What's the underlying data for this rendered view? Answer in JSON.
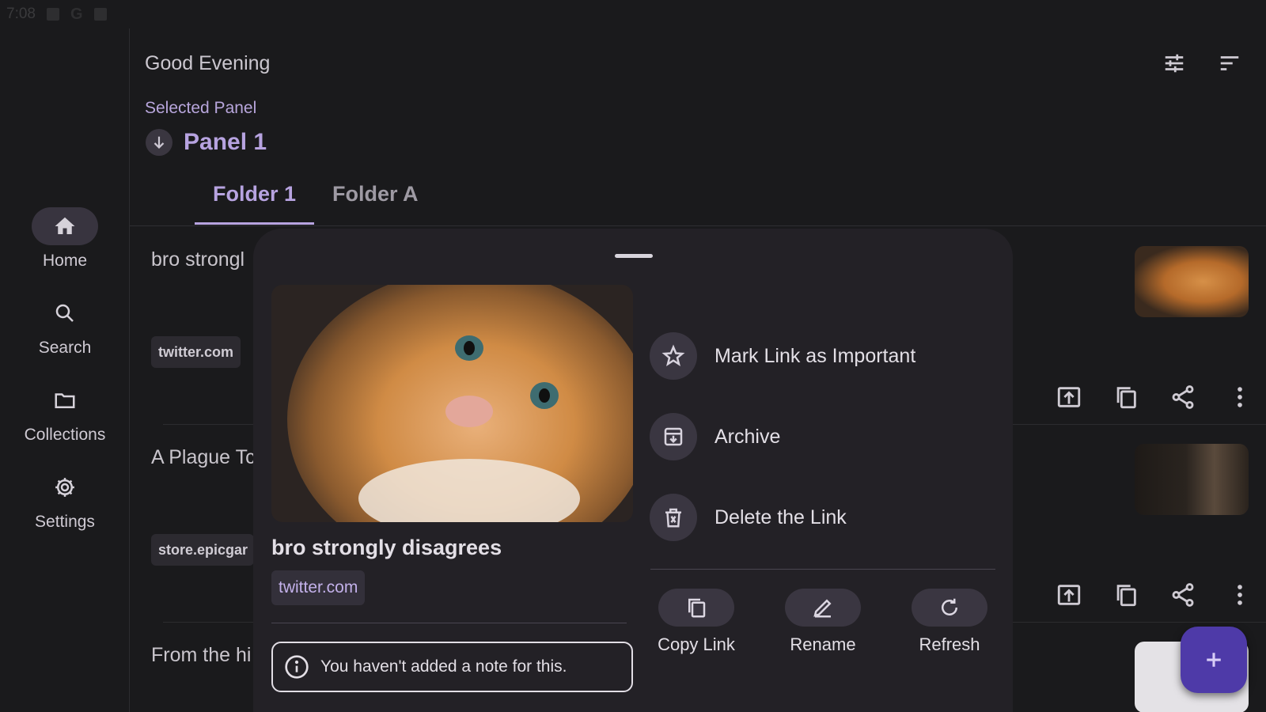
{
  "status_bar": {
    "time": "7:08"
  },
  "nav": {
    "items": [
      {
        "label": "Home",
        "icon": "home-icon",
        "active": true
      },
      {
        "label": "Search",
        "icon": "search-icon",
        "active": false
      },
      {
        "label": "Collections",
        "icon": "folder-icon",
        "active": false
      },
      {
        "label": "Settings",
        "icon": "gear-icon",
        "active": false
      }
    ]
  },
  "header": {
    "greeting": "Good Evening",
    "selected_panel_label": "Selected Panel",
    "panel_name": "Panel 1"
  },
  "tabs": [
    {
      "label": "Folder 1",
      "active": true
    },
    {
      "label": "Folder A",
      "active": false
    }
  ],
  "links": [
    {
      "title": "bro strongl",
      "host": "twitter.com"
    },
    {
      "title": "A Plague Tc",
      "host": "store.epicgar"
    },
    {
      "title": "From the hi"
    }
  ],
  "sheet": {
    "title": "bro strongly disagrees",
    "host": "twitter.com",
    "note": "You haven't added a note for this.",
    "actions": [
      {
        "label": "Mark Link as Important",
        "icon": "star-icon"
      },
      {
        "label": "Archive",
        "icon": "archive-icon"
      },
      {
        "label": "Delete the Link",
        "icon": "delete-icon"
      }
    ],
    "buttons": [
      {
        "label": "Copy Link",
        "icon": "copy-icon"
      },
      {
        "label": "Rename",
        "icon": "edit-icon"
      },
      {
        "label": "Refresh",
        "icon": "refresh-icon"
      }
    ]
  },
  "colors": {
    "accent": "#b7a3e0",
    "fab": "#4e3aa8",
    "background": "#1a1a1c",
    "sheet": "#232126"
  }
}
